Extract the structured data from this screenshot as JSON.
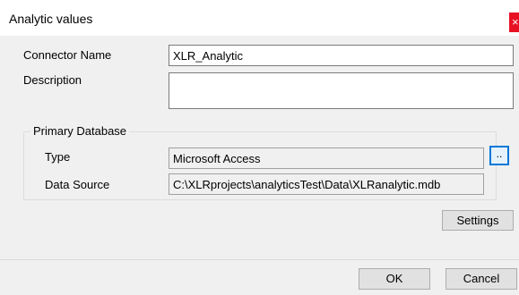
{
  "window": {
    "title": "Analytic values",
    "close_glyph": "×"
  },
  "form": {
    "connector_name_label": "Connector Name",
    "connector_name_value": "XLR_Analytic",
    "description_label": "Description",
    "description_value": ""
  },
  "primary_database": {
    "group_label": "Primary Database",
    "type_label": "Type",
    "type_value": "Microsoft Access",
    "browse_label": "..",
    "data_source_label": "Data Source",
    "data_source_value": "C:\\XLRprojects\\analyticsTest\\Data\\XLRanalytic.mdb"
  },
  "buttons": {
    "settings": "Settings",
    "ok": "OK",
    "cancel": "Cancel"
  },
  "colors": {
    "close_button": "#e81123",
    "focus_border": "#0078d7",
    "dialog_background": "#f0f0f0"
  }
}
